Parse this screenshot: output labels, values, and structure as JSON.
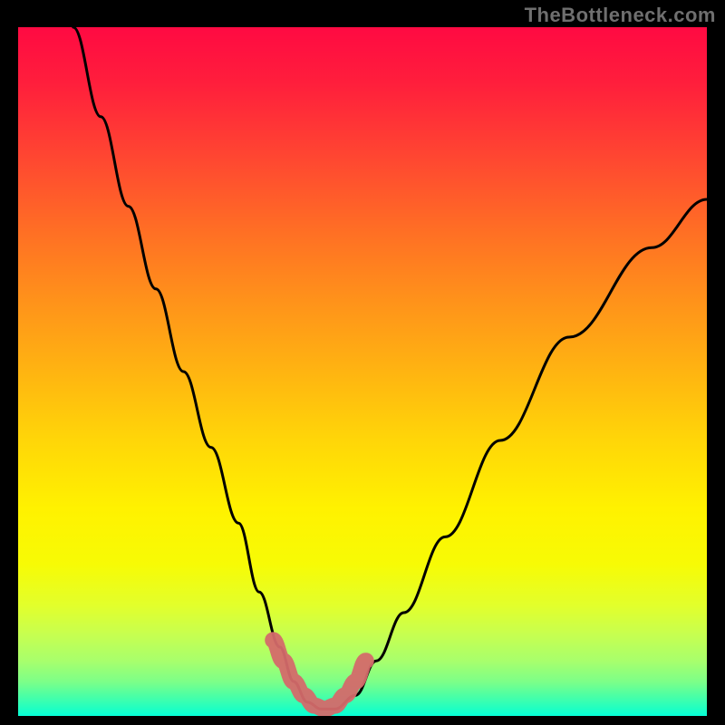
{
  "watermark": "TheBottleneck.com",
  "chart_data": {
    "type": "line",
    "title": "",
    "xlabel": "",
    "ylabel": "",
    "xlim": [
      0,
      100
    ],
    "ylim": [
      0,
      100
    ],
    "grid": false,
    "series": [
      {
        "name": "bottleneck-curve",
        "x": [
          8,
          12,
          16,
          20,
          24,
          28,
          32,
          35,
          38,
          40,
          42,
          44,
          46,
          49,
          52,
          56,
          62,
          70,
          80,
          92,
          100
        ],
        "y": [
          100,
          87,
          74,
          62,
          50,
          39,
          28,
          18,
          10,
          5,
          2,
          1,
          1,
          3,
          8,
          15,
          26,
          40,
          55,
          68,
          75
        ]
      }
    ],
    "highlight": {
      "name": "optimal-range",
      "x": [
        37,
        38.5,
        40,
        41.5,
        43,
        44.5,
        46,
        47.5,
        49,
        50.5
      ],
      "y": [
        11,
        8,
        5,
        3,
        1.5,
        1,
        1.5,
        3,
        5,
        8
      ]
    },
    "gradient_stops": [
      {
        "pos": 0,
        "color": "#ff0a42"
      },
      {
        "pos": 50,
        "color": "#ffd608"
      },
      {
        "pos": 100,
        "color": "#05ffd8"
      }
    ]
  }
}
